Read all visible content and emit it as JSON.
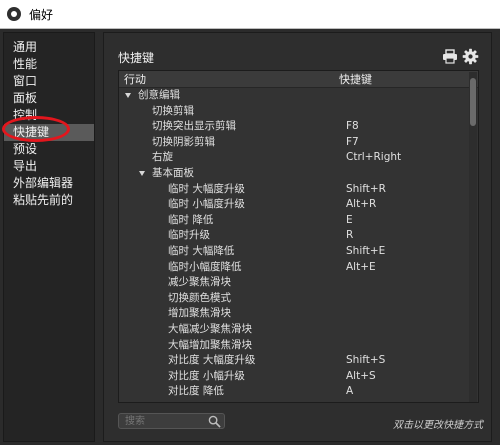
{
  "window": {
    "title": "偏好"
  },
  "sidebar": {
    "items": [
      {
        "label": "通用"
      },
      {
        "label": "性能"
      },
      {
        "label": "窗口"
      },
      {
        "label": "面板"
      },
      {
        "label": "控制"
      },
      {
        "label": "快捷键",
        "selected": true
      },
      {
        "label": "预设"
      },
      {
        "label": "导出"
      },
      {
        "label": "外部编辑器"
      },
      {
        "label": "粘贴先前的"
      }
    ]
  },
  "main": {
    "heading": "快捷键",
    "table": {
      "col_action": "行动",
      "col_shortcut": "快捷键",
      "rows": [
        {
          "level": 0,
          "expanded": true,
          "action": "创意编辑",
          "shortcut": ""
        },
        {
          "level": 1,
          "action": "切换剪辑",
          "shortcut": ""
        },
        {
          "level": 1,
          "action": "切换突出显示剪辑",
          "shortcut": "F8"
        },
        {
          "level": 1,
          "action": "切换阴影剪辑",
          "shortcut": "F7"
        },
        {
          "level": 1,
          "action": "右旋",
          "shortcut": "Ctrl+Right"
        },
        {
          "level": 1,
          "expanded": true,
          "action": "基本面板",
          "shortcut": ""
        },
        {
          "level": 2,
          "action": "临时 大幅度升级",
          "shortcut": "Shift+R"
        },
        {
          "level": 2,
          "action": "临时 小幅度升级",
          "shortcut": "Alt+R"
        },
        {
          "level": 2,
          "action": "临时 降低",
          "shortcut": "E"
        },
        {
          "level": 2,
          "action": "临时升级",
          "shortcut": "R"
        },
        {
          "level": 2,
          "action": "临时 大幅降低",
          "shortcut": "Shift+E"
        },
        {
          "level": 2,
          "action": "临时小幅度降低",
          "shortcut": "Alt+E"
        },
        {
          "level": 2,
          "action": "减少聚焦滑块",
          "shortcut": ""
        },
        {
          "level": 2,
          "action": "切换颜色模式",
          "shortcut": ""
        },
        {
          "level": 2,
          "action": "增加聚焦滑块",
          "shortcut": ""
        },
        {
          "level": 2,
          "action": "大幅减少聚焦滑块",
          "shortcut": ""
        },
        {
          "level": 2,
          "action": "大幅增加聚焦滑块",
          "shortcut": ""
        },
        {
          "level": 2,
          "action": "对比度 大幅度升级",
          "shortcut": "Shift+S"
        },
        {
          "level": 2,
          "action": "对比度 小幅升级",
          "shortcut": "Alt+S"
        },
        {
          "level": 2,
          "action": "对比度 降低",
          "shortcut": "A"
        }
      ]
    },
    "search": {
      "placeholder": "搜索"
    },
    "hint": "双击以更改快捷方式"
  },
  "icons": {
    "window": "app-icon",
    "print": "print-icon",
    "settings": "gear-icon",
    "search": "search-icon",
    "expand": "expand-triangle-icon"
  },
  "colors": {
    "annotation": "#e3161d",
    "selected_bg": "#5a5a5a",
    "panel_bg": "#2b2b2b"
  }
}
